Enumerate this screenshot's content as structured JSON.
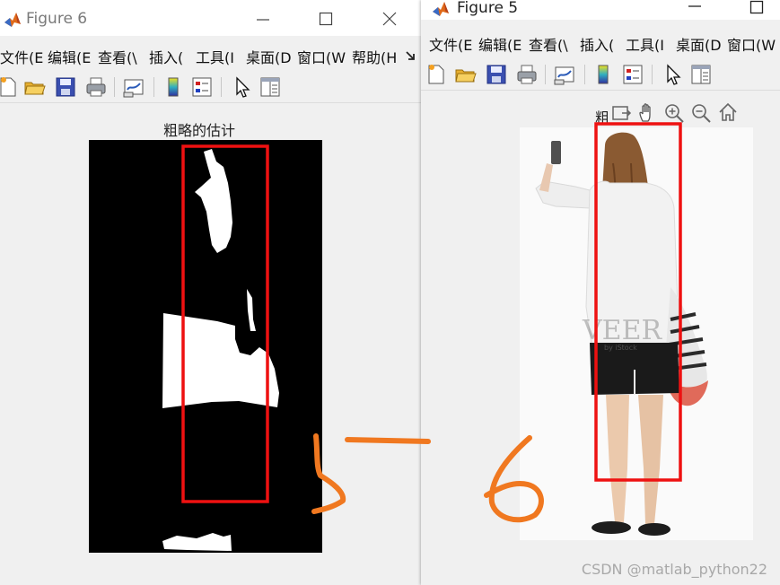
{
  "figure6": {
    "window_title": "Figure 6",
    "menu": [
      "文件(E",
      "编辑(E",
      "查看(\\",
      "插入(",
      "工具(I",
      "桌面(D",
      "窗口(W",
      "帮助(H"
    ],
    "overflow_icon": "toolbar-overflow-icon",
    "toolbar_icons": [
      "new-file-icon",
      "open-folder-icon",
      "save-icon",
      "print-icon",
      "link-plot-icon",
      "colorbar-icon",
      "legend-icon",
      "pointer-icon",
      "property-inspector-icon"
    ],
    "axes_title": "粗略的估计"
  },
  "figure5": {
    "window_title": "Figure 5",
    "menu": [
      "文件(E",
      "编辑(E",
      "查看(\\",
      "插入(",
      "工具(I",
      "桌面(D",
      "窗口(W"
    ],
    "toolbar_icons": [
      "new-file-icon",
      "open-folder-icon",
      "save-icon",
      "print-icon",
      "link-plot-icon",
      "colorbar-icon",
      "legend-icon",
      "pointer-icon",
      "property-inspector-icon"
    ],
    "axes_title_partial": "粗",
    "axes_tools": [
      "export-icon",
      "pan-hand-icon",
      "zoom-in-icon",
      "zoom-out-icon",
      "home-icon"
    ]
  },
  "colors": {
    "detection_box": "#ee1111",
    "annotation": "#f07820"
  },
  "watermark": "CSDN @matlab_python22"
}
